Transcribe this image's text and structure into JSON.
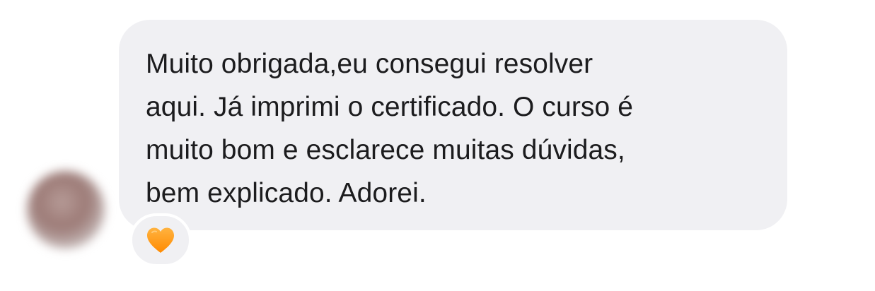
{
  "message": {
    "lines": [
      "Muito obrigada,eu consegui resolver",
      "aqui. Já imprimi o certificado. O curso é",
      "muito bom e esclarece muitas dúvidas,",
      "bem explicado. Adorei."
    ]
  },
  "reaction": {
    "icon": "orange-heart-icon",
    "color": "#ff9500"
  },
  "colors": {
    "bubble_background": "#f0f0f3",
    "text": "#1c1c1e"
  }
}
